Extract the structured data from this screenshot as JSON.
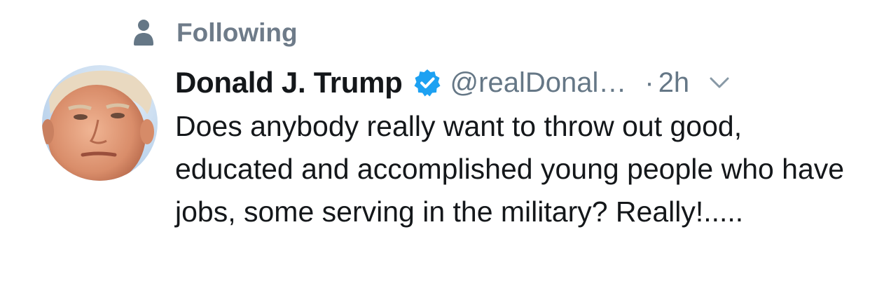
{
  "social_context": {
    "icon": "person-icon",
    "label": "Following"
  },
  "tweet": {
    "avatar": "profile-photo",
    "display_name": "Donald J. Trump",
    "verified": true,
    "verified_color": "#1da1f2",
    "handle": "@realDonal…",
    "dot": "·",
    "timestamp": "2h",
    "menu_icon": "chevron-down-icon",
    "text": "Does anybody really want to throw out good, educated and accomplished young people who have jobs, some serving in the military? Really!....."
  },
  "colors": {
    "secondary_text": "#657786",
    "primary_text": "#14171a"
  }
}
